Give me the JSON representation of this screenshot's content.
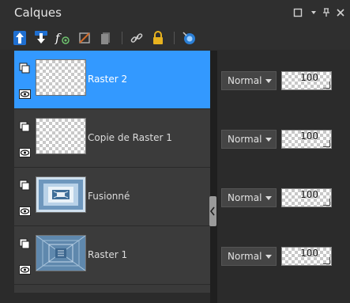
{
  "panel": {
    "title": "Calques"
  },
  "window_controls": [
    {
      "name": "restore-icon"
    },
    {
      "name": "menu-dropdown-icon"
    },
    {
      "name": "pin-icon"
    },
    {
      "name": "close-icon"
    }
  ],
  "toolbar": {
    "tools": [
      {
        "name": "move-layer-up-icon"
      },
      {
        "name": "move-layer-down-icon"
      },
      {
        "name": "layer-effects-icon"
      },
      {
        "name": "delete-layer-icon"
      },
      {
        "name": "merge-layer-icon"
      },
      {
        "name": "link-icon"
      },
      {
        "name": "lock-icon"
      },
      {
        "name": "mask-icon"
      }
    ]
  },
  "layers": [
    {
      "name": "Raster 2",
      "thumb": "transparent",
      "selected": true,
      "blend_mode": "Normal",
      "opacity": "100"
    },
    {
      "name": "Copie de Raster 1",
      "thumb": "transparent",
      "selected": false,
      "blend_mode": "Normal",
      "opacity": "100"
    },
    {
      "name": "Fusionné",
      "thumb": "image",
      "selected": false,
      "blend_mode": "Normal",
      "opacity": "100"
    },
    {
      "name": "Raster 1",
      "thumb": "image",
      "selected": false,
      "blend_mode": "Normal",
      "opacity": "100"
    }
  ],
  "colors": {
    "selection": "#3399ff",
    "panel_bg": "#2b2b2b",
    "row_bg": "#3b3b3b"
  }
}
